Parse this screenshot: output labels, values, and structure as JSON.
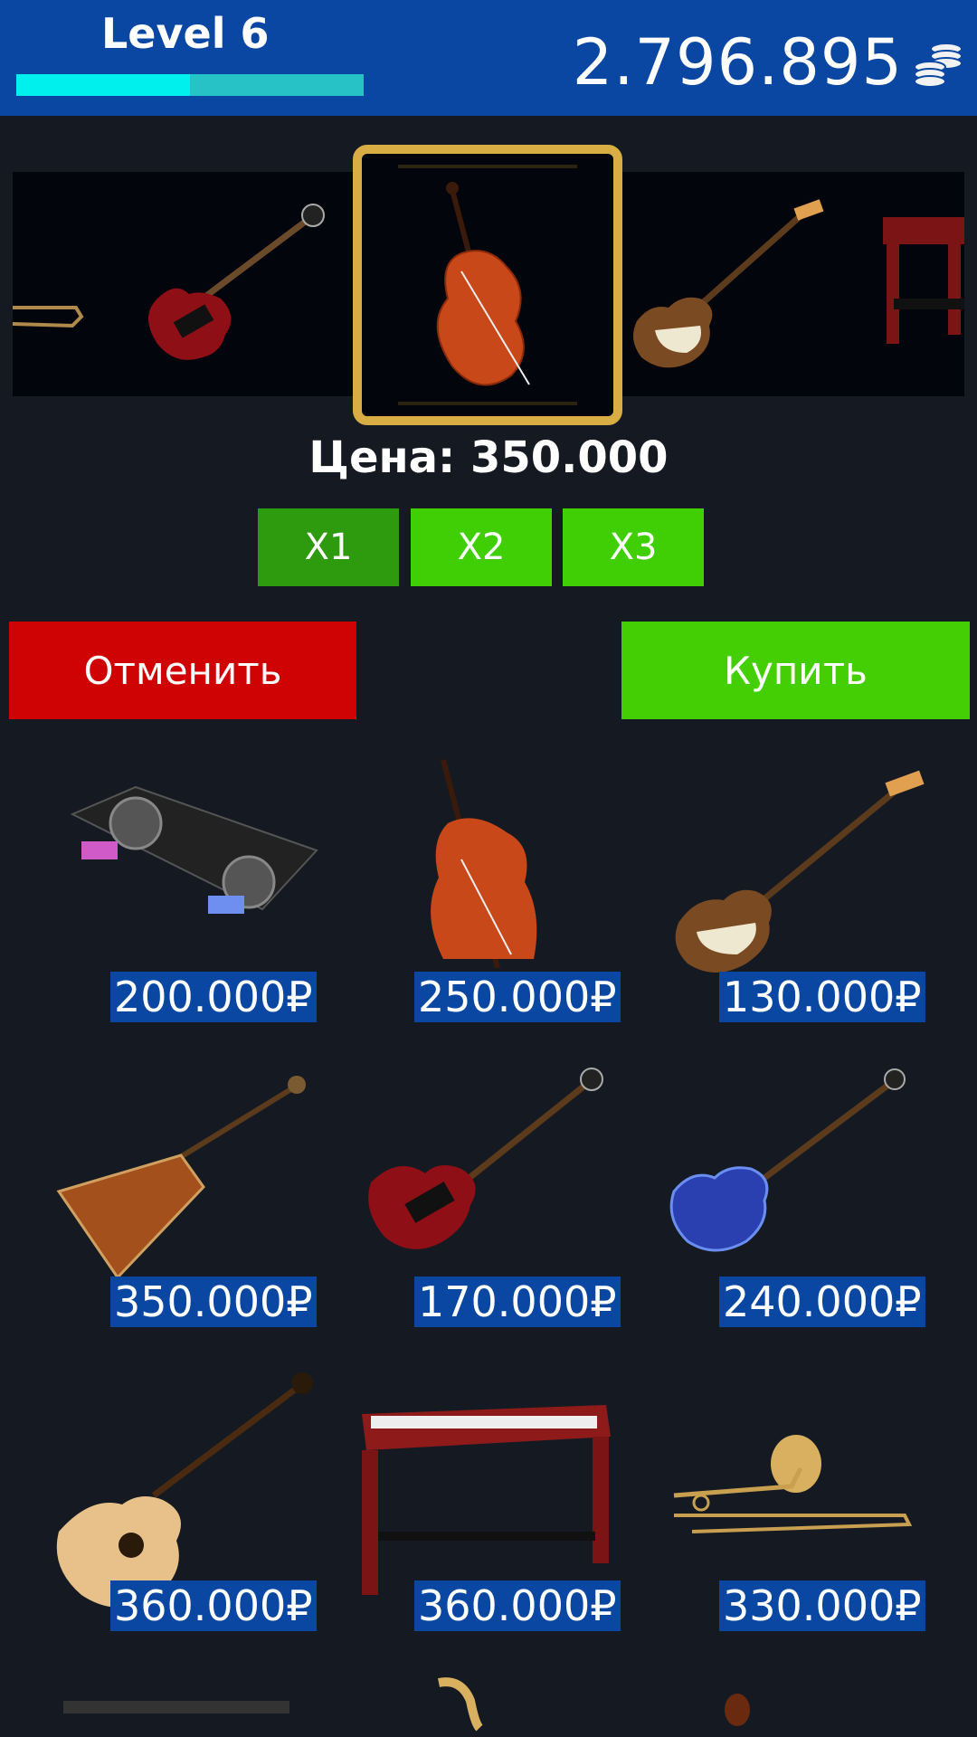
{
  "header": {
    "level_label": "Level 6",
    "xp_progress": 0.5,
    "coins": "2.796.895",
    "coin_icon": "coins-stack-icon"
  },
  "carousel": {
    "items": [
      "trombone",
      "red-electric-guitar",
      "double-bass",
      "bass-guitar",
      "red-piano"
    ],
    "selected": "double-bass"
  },
  "price_label": "Цена: 350.000",
  "multipliers": [
    {
      "label": "X1",
      "active": true
    },
    {
      "label": "X2",
      "active": false
    },
    {
      "label": "X3",
      "active": false
    }
  ],
  "buttons": {
    "cancel": "Отменить",
    "buy": "Купить"
  },
  "shop_items": [
    {
      "name": "dj-controller",
      "price": "200.000₽"
    },
    {
      "name": "double-bass",
      "price": "250.000₽"
    },
    {
      "name": "bass-guitar",
      "price": "130.000₽"
    },
    {
      "name": "flying-v-guitar",
      "price": "350.000₽"
    },
    {
      "name": "red-sg-guitar",
      "price": "170.000₽"
    },
    {
      "name": "blue-les-paul-guitar",
      "price": "240.000₽"
    },
    {
      "name": "acoustic-guitar",
      "price": "360.000₽"
    },
    {
      "name": "digital-piano",
      "price": "360.000₽"
    },
    {
      "name": "trombone",
      "price": "330.000₽"
    }
  ],
  "colors": {
    "background": "#151a22",
    "header": "#0a47a2",
    "xp_fill": "#00f0ee",
    "cancel": "#cf0303",
    "buy": "#43cf04",
    "frame": "#d8ad44"
  }
}
